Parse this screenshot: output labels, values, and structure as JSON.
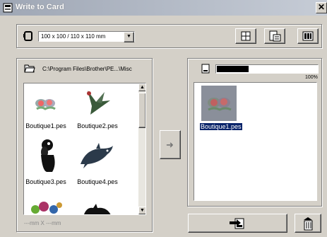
{
  "window": {
    "title": "Write to Card",
    "close_glyph": "✕"
  },
  "toolbar": {
    "hoop_icon": "hoop-icon",
    "hoop_select_value": "100 x 100 / 110 x 110 mm",
    "dropdown_arrow": "▼"
  },
  "left_panel": {
    "folder_path": "C:\\Program Files\\Brother\\PE...\\Misc",
    "files": [
      {
        "label": "Boutique1.pes"
      },
      {
        "label": "Boutique2.pes"
      },
      {
        "label": "Boutique3.pes"
      },
      {
        "label": "Boutique4.pes"
      }
    ],
    "size_readout": "---mm X ---mm"
  },
  "transfer": {
    "arrow_glyph": "➜"
  },
  "right_panel": {
    "capacity_percent": 100,
    "capacity_fill_fraction": 0.32,
    "capacity_label": "100%",
    "card_files": [
      {
        "label": "Boutique1.pes",
        "selected": true
      }
    ]
  },
  "colors": {
    "accent_selection": "#0a246a",
    "face": "#d4d0c8"
  }
}
